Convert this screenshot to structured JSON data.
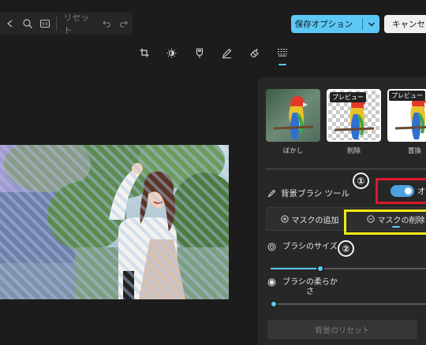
{
  "toolbar": {
    "reset_label": "リセット"
  },
  "header": {
    "save_label": "保存オプション",
    "cancel_label": "キャンセル"
  },
  "modes": {
    "items": [
      "crop-icon",
      "adjust-icon",
      "filter-icon",
      "markup-icon",
      "erase-icon",
      "background-icon"
    ],
    "active": "background-icon"
  },
  "panel": {
    "thumbs": [
      {
        "label": "ぼかし",
        "badge": ""
      },
      {
        "label": "削除",
        "badge": "プレビュー"
      },
      {
        "label": "置換",
        "badge": "プレビュー"
      }
    ],
    "brush_tool_label": "背景ブラシ ツール",
    "toggle_label": "オン",
    "toggle_state": true,
    "add_mask_label": "マスクの追加",
    "remove_mask_label": "マスクの削除",
    "brush_size_label": "ブラシのサイズ",
    "brush_size_value": 0.3,
    "brush_softness_label": "ブラシの柔らかさ",
    "brush_softness_value": 0.02,
    "reset_bg_label": "背景のリセット"
  },
  "annotations": {
    "one": "①",
    "two": "②",
    "red": "#e0182b",
    "yellow": "#f2ea14"
  },
  "colors": {
    "accent": "#5cc8f5",
    "panel": "#272727",
    "background": "#1c1c1c"
  }
}
